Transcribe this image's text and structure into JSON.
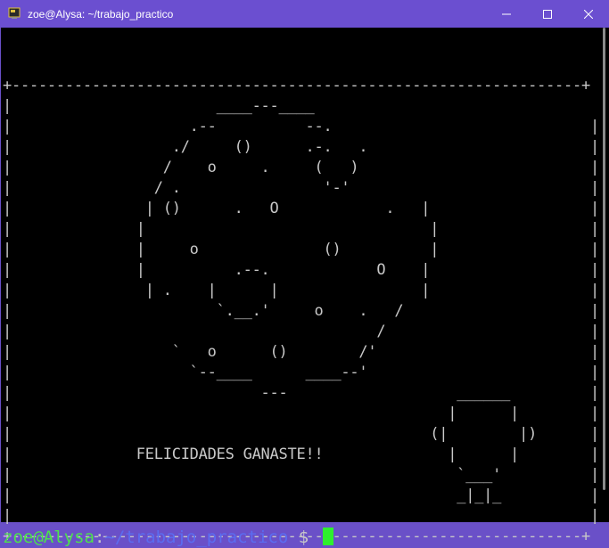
{
  "window": {
    "title": "zoe@Alysa: ~/trabajo_practico",
    "icon": "terminal-app-icon",
    "controls": [
      "minimize-icon",
      "maximize-icon",
      "close-icon"
    ]
  },
  "terminal": {
    "ascii_art": "+----------------------------------------------------------------+\n|                       ____---____                                |\n|                    .--          --.                             |\n|                  ./     ()      .-.   .                         |\n|                 /    o     .     (   )                          |\n|                / .                '-'                           |\n|               | ()      .   O            .   |                  |\n|              |                                |                 |\n|              |     o              ()          |                 |\n|              |          .--.            O    |                  |\n|               | .    |      |                |                  |\n|                       `.__.'     o    .   /                     |\n|                                         /                       |\n|                  `   o      ()        /'                        |\n|                    `--____      ____--'                         |\n|                            ---                   ______         |\n|                                                 |      |        |\n|                                               (|        |)      |\n|              FELICIDADES GANASTE!!              |      |        |\n|                                                  `___'          |\n|                                                  _|_|_          |\n|                                                                 |\n+----------------------------------------------------------------+",
    "prompt_user": "zoe@Alysa",
    "prompt_colon": ":",
    "prompt_path": "~/trabajo_practico",
    "prompt_symbol": " $ "
  },
  "colors": {
    "titlebar": "#6b4fd0",
    "terminal_bg": "#000000",
    "text": "#c8c8c8",
    "prompt_user": "#4ee04e",
    "prompt_path": "#5b6cf0",
    "cursor": "#2ef02e"
  }
}
